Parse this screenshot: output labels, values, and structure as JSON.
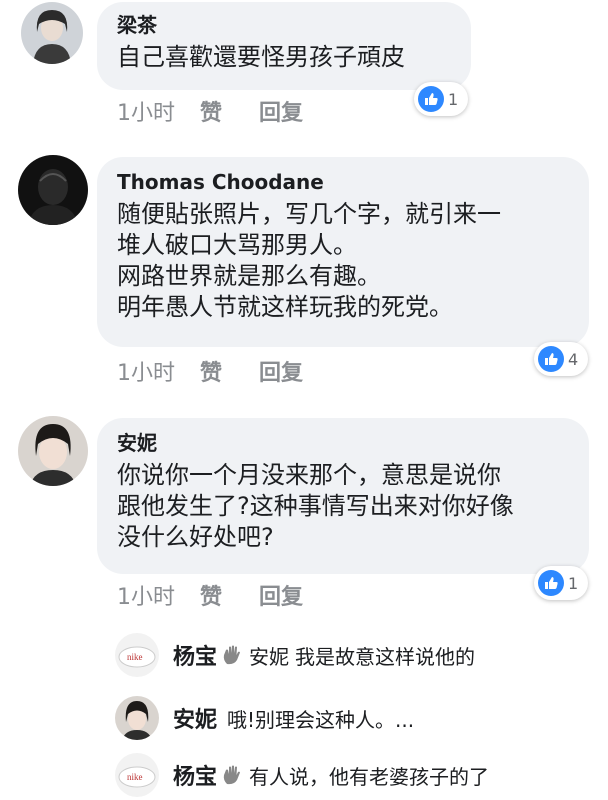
{
  "comments": [
    {
      "author": "梁茶",
      "lines": [
        "自己喜歡還要怪男孩子頑皮"
      ],
      "time": "1小时",
      "like": "赞",
      "reply": "回复",
      "reactions": "1"
    },
    {
      "author": "Thomas Choodane",
      "lines": [
        "随便貼张照片，写几个字，就引来一",
        "堆人破口大骂那男人。",
        "网路世界就是那么有趣。",
        "明年愚人节就这样玩我的死党。"
      ],
      "time": "1小时",
      "like": "赞",
      "reply": "回复",
      "reactions": "4"
    },
    {
      "author": "安妮",
      "lines": [
        "你说你一个月没来那个，意思是说你",
        "跟他发生了?这种事情写出来对你好像",
        "没什么好处吧?"
      ],
      "time": "1小时",
      "like": "赞",
      "reply": "回复",
      "reactions": "1"
    }
  ],
  "replies": [
    {
      "author": "杨宝",
      "mention": "安妮",
      "text": "我是故意这样说他的",
      "icon": "wave-hand-icon"
    },
    {
      "author": "安妮",
      "text": "哦!别理会这种人。...",
      "icon": ""
    },
    {
      "author": "杨宝",
      "text": "有人说，他有老婆孩子的了",
      "icon": "wave-hand-icon"
    }
  ],
  "colors": {
    "bubble": "#f0f2f5",
    "like_blue": "#2d88ff",
    "meta_gray": "#8a8d91"
  }
}
